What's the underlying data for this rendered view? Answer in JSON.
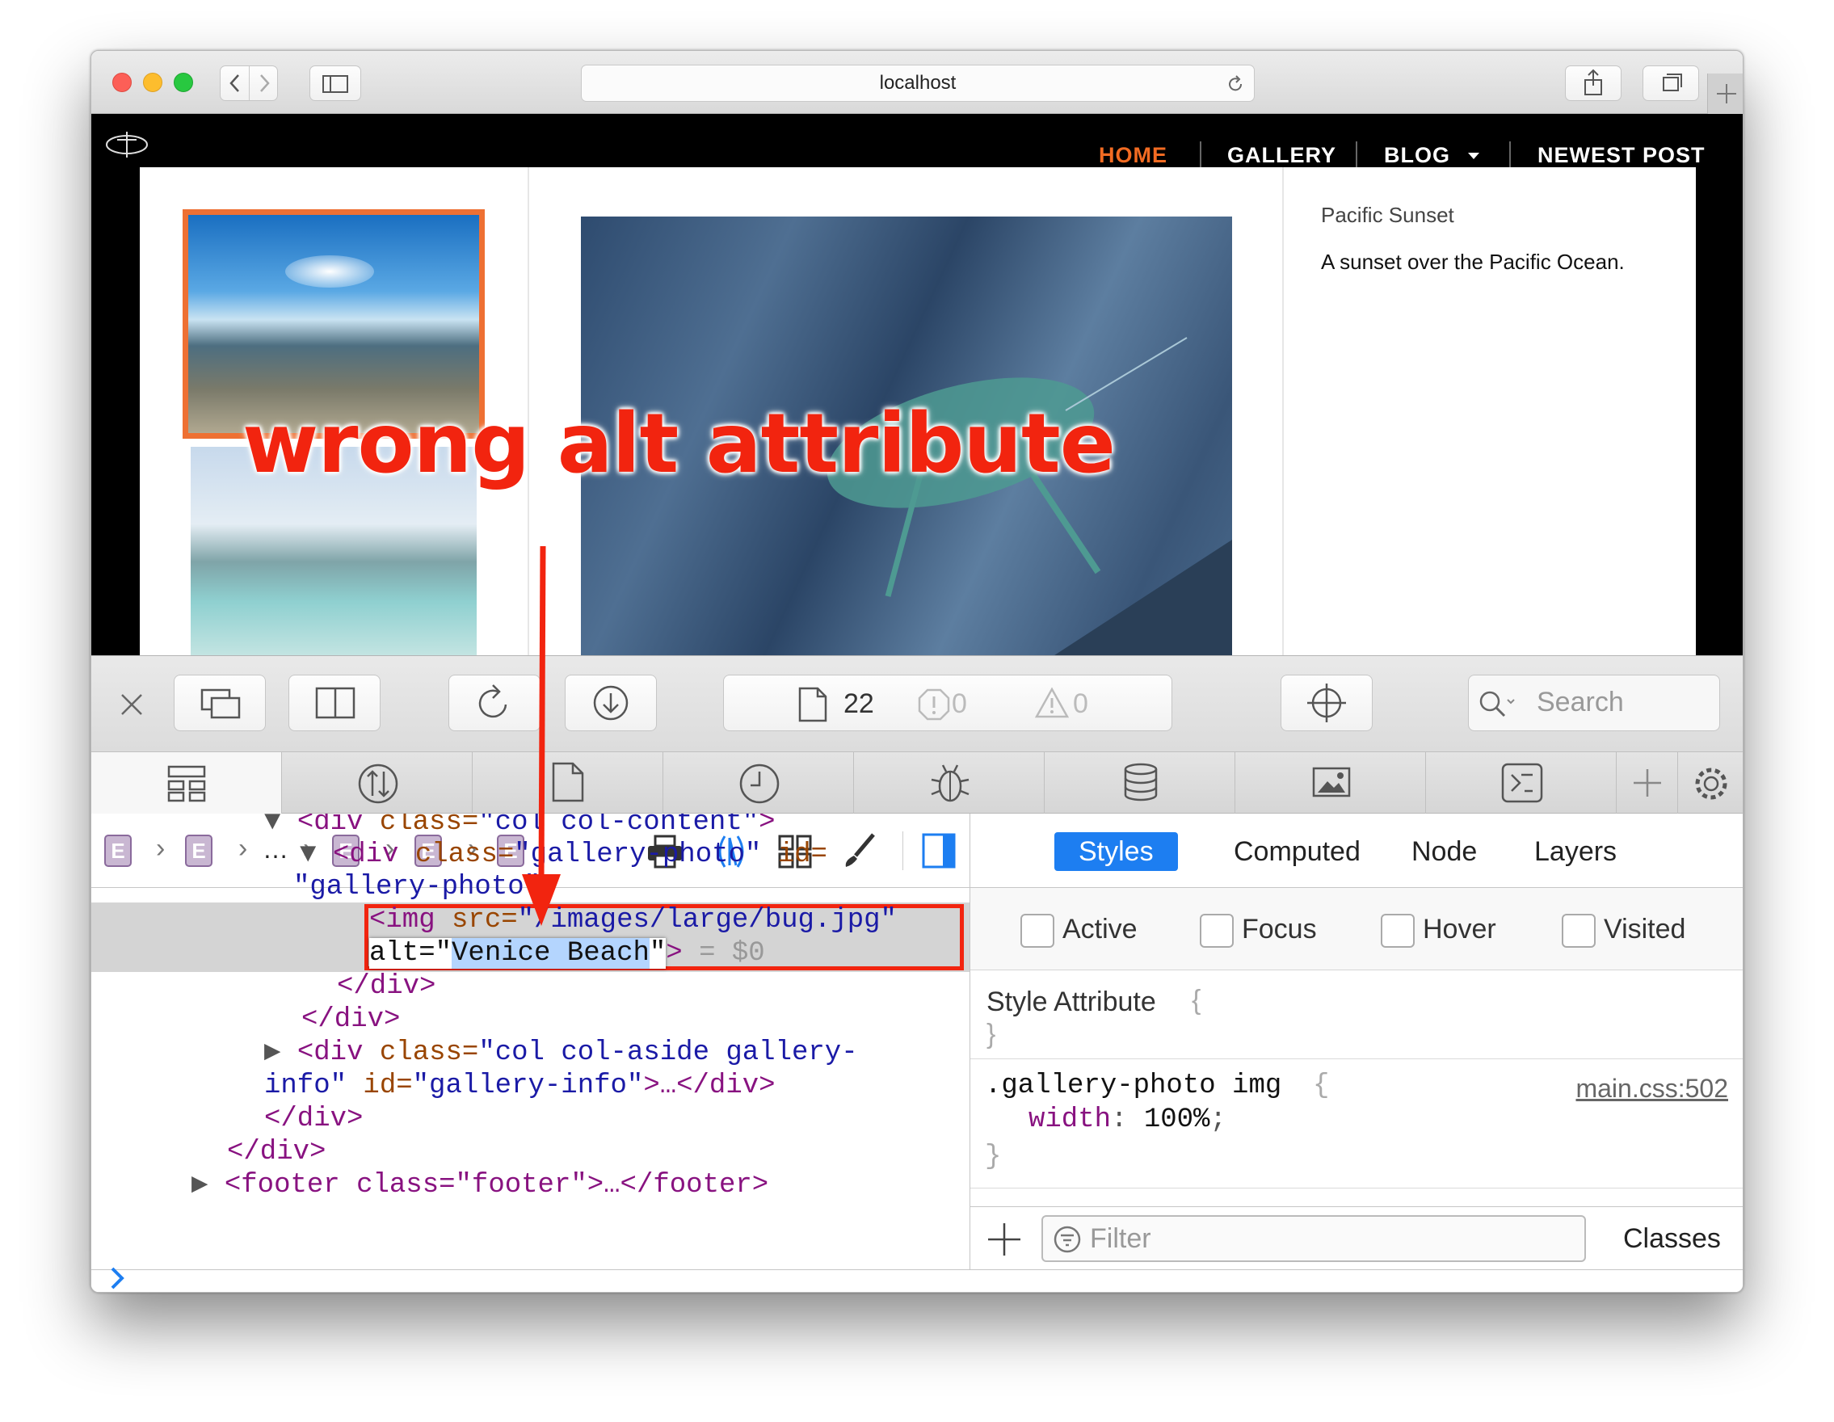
{
  "browser": {
    "url": "localhost"
  },
  "site": {
    "nav": [
      "HOME",
      "GALLERY",
      "BLOG",
      "NEWEST POST"
    ],
    "active_nav_color": "#f26b22",
    "info_title": "Pacific Sunset",
    "info_text": "A sunset over the Pacific Ocean."
  },
  "devtools": {
    "resources_count": "22",
    "errors_count": "0",
    "warnings_count": "0",
    "search_placeholder": "Search",
    "breadcrumb": [
      "E",
      "E",
      "…",
      "E",
      "E",
      "E"
    ],
    "dom": {
      "l1_tag": "<div ",
      "l1_attr": "class=",
      "l1_val": "\"col col-content\"",
      "l1_end": ">",
      "l2_tag": "<div ",
      "l2_attr": "class=",
      "l2_val": "\"gallery-photo\"",
      "l2_attr2": " id=",
      "l3_val": "\"gallery-photo\"",
      "l3_end": ">",
      "l4_tag": "<img ",
      "l4_attr": "src=",
      "l4_val": "\"/images/large/bug.jpg\"",
      "l5_attr": "alt=",
      "l5_q1": "\"",
      "l5_val": "Venice Beach",
      "l5_q2": "\"",
      "l5_end": ">",
      "l5_ref": " = $0",
      "l6": "</div>",
      "l7": "</div>",
      "l8_tag": "<div ",
      "l8_attr": "class=",
      "l8_val": "\"col col-aside gallery-",
      "l9_val": "info\"",
      "l9_attr": " id=",
      "l9_val2": "\"gallery-info\"",
      "l9_rest": ">…</div>",
      "l10": "</div>",
      "l11": "</div>",
      "l12": "<footer class=\"footer\">…</footer>"
    },
    "sidebar_tabs": [
      "Styles",
      "Computed",
      "Node",
      "Layers"
    ],
    "pseudo_classes": [
      "Active",
      "Focus",
      "Hover",
      "Visited"
    ],
    "style_attribute_label": "Style Attribute",
    "rule_selector": ".gallery-photo img",
    "rule_source": "main.css:502",
    "rule_prop": "width",
    "rule_value": "100%",
    "filter_placeholder": "Filter",
    "classes_label": "Classes"
  },
  "annotation": {
    "text": "wrong alt attribute",
    "color": "#f2240f"
  }
}
